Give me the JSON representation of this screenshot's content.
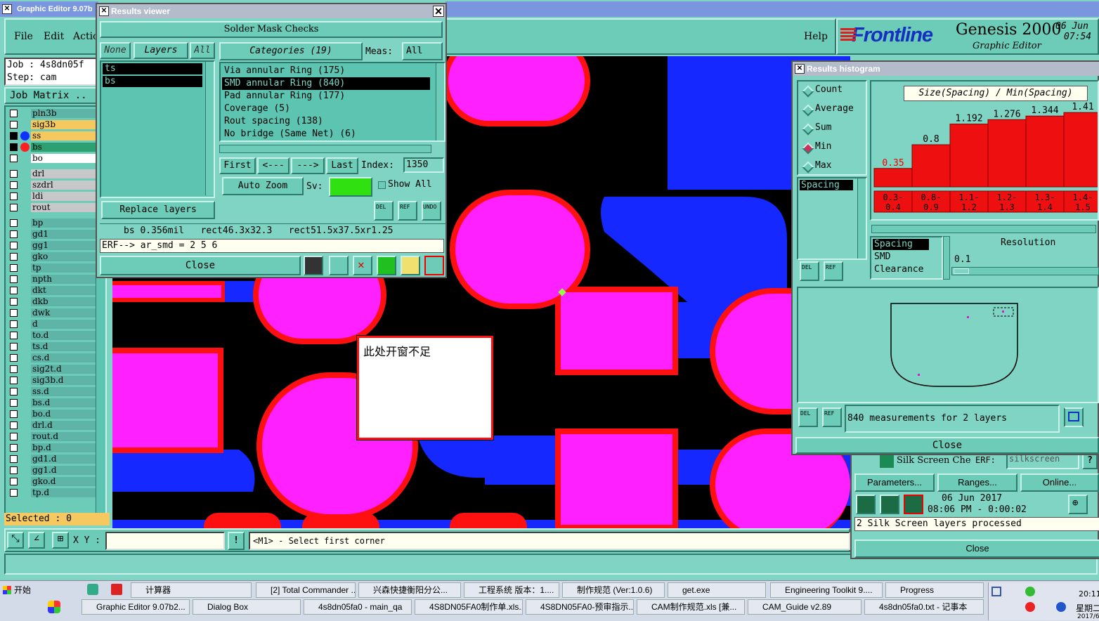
{
  "main_window": {
    "title": "Graphic Editor 9.07b",
    "menu": {
      "file": "File",
      "edit": "Edit",
      "actions": "Actio",
      "help": "Help"
    },
    "job": "Job : 4s8dn05f",
    "step": "Step: cam",
    "job_matrix": "Job Matrix ..",
    "selected": "Selected : 0",
    "xy_label": "X Y :",
    "xy_value": "",
    "hint_btn": "!",
    "hint": "<M1> - Select first corner"
  },
  "brand": {
    "logo": "Frontline",
    "product": "Genesis 2000",
    "subtitle": "Graphic Editor",
    "date": "06 Jun",
    "time": "07:54"
  },
  "layers": [
    {
      "name": "pln3b",
      "color": "#5fb4a8",
      "dot": ""
    },
    {
      "name": "sig3b",
      "color": "#f5c860",
      "dot": ""
    },
    {
      "name": "ss",
      "color": "#f5c860",
      "dot": "#1030ff"
    },
    {
      "name": "bs",
      "color": "#2ca070",
      "dot": "#ff2020"
    },
    {
      "name": "bo",
      "color": "#ffffff",
      "dot": ""
    },
    {
      "name": "drl",
      "color": "#c8c8c8",
      "dot": ""
    },
    {
      "name": "szdrl",
      "color": "#c8c8c8",
      "dot": ""
    },
    {
      "name": "ldi",
      "color": "#c8c8c8",
      "dot": ""
    },
    {
      "name": "rout",
      "color": "#c8c8c8",
      "dot": ""
    },
    {
      "name": "bp",
      "color": "#5fb4a8",
      "dot": ""
    },
    {
      "name": "gd1",
      "color": "#5fb4a8",
      "dot": ""
    },
    {
      "name": "gg1",
      "color": "#5fb4a8",
      "dot": ""
    },
    {
      "name": "gko",
      "color": "#5fb4a8",
      "dot": ""
    },
    {
      "name": "tp",
      "color": "#5fb4a8",
      "dot": ""
    },
    {
      "name": "npth",
      "color": "#5fb4a8",
      "dot": ""
    },
    {
      "name": "dkt",
      "color": "#5fb4a8",
      "dot": ""
    },
    {
      "name": "dkb",
      "color": "#5fb4a8",
      "dot": ""
    },
    {
      "name": "dwk",
      "color": "#5fb4a8",
      "dot": ""
    },
    {
      "name": "d",
      "color": "#5fb4a8",
      "dot": ""
    },
    {
      "name": "to.d",
      "color": "#5fb4a8",
      "dot": ""
    },
    {
      "name": "ts.d",
      "color": "#5fb4a8",
      "dot": ""
    },
    {
      "name": "cs.d",
      "color": "#5fb4a8",
      "dot": ""
    },
    {
      "name": "sig2t.d",
      "color": "#5fb4a8",
      "dot": ""
    },
    {
      "name": "sig3b.d",
      "color": "#5fb4a8",
      "dot": ""
    },
    {
      "name": "ss.d",
      "color": "#5fb4a8",
      "dot": ""
    },
    {
      "name": "bs.d",
      "color": "#5fb4a8",
      "dot": ""
    },
    {
      "name": "bo.d",
      "color": "#5fb4a8",
      "dot": ""
    },
    {
      "name": "drl.d",
      "color": "#5fb4a8",
      "dot": ""
    },
    {
      "name": "rout.d",
      "color": "#5fb4a8",
      "dot": ""
    },
    {
      "name": "bp.d",
      "color": "#5fb4a8",
      "dot": ""
    },
    {
      "name": "gd1.d",
      "color": "#5fb4a8",
      "dot": ""
    },
    {
      "name": "gg1.d",
      "color": "#5fb4a8",
      "dot": ""
    },
    {
      "name": "gko.d",
      "color": "#5fb4a8",
      "dot": ""
    },
    {
      "name": "tp.d",
      "color": "#5fb4a8",
      "dot": ""
    }
  ],
  "results_viewer": {
    "title": "Results viewer",
    "header": "Solder Mask Checks",
    "none": "None",
    "layers_label": "Layers",
    "all": "All",
    "categories_label": "Categories (19)",
    "meas_label": "Meas:",
    "meas_value": "All",
    "layer_items": [
      "ts",
      "bs"
    ],
    "categories": [
      "Via annular Ring (175)",
      "SMD annular Ring (840)",
      "Pad annular Ring (177)",
      "Coverage (5)",
      "Rout spacing (138)",
      "No bridge (Same Net) (6)"
    ],
    "first": "First",
    "prev": "<---",
    "next": "--->",
    "last": "Last",
    "index_label": "Index:",
    "index_value": "1350",
    "auto_zoom": "Auto Zoom",
    "sv_label": "Sv:",
    "show_all": "Show All",
    "replace_layers": "Replace layers",
    "del": "DEL",
    "ref": "REF",
    "undo": "UNDO",
    "info": "bs 0.356mil   rect46.3x32.3   rect51.5x37.5xr1.25",
    "erf": "ERF--> ar_smd = 2 5 6",
    "close": "Close"
  },
  "canvas": {
    "annotation": "此处开窗不足"
  },
  "histogram": {
    "title": "Results histogram",
    "options": [
      "Count",
      "Average",
      "Sum",
      "Min",
      "Max"
    ],
    "selected_option": "Min",
    "type_list": [
      "Spacing"
    ],
    "chart_title": "Size(Spacing) / Min(Spacing)",
    "list2": [
      "Spacing",
      "SMD",
      "Clearance"
    ],
    "resolution_label": "Resolution",
    "resolution_value": "0.1",
    "measurements": "840 measurements for 2 layers",
    "close": "Close",
    "del": "DEL",
    "ref": "REF",
    "chart_data": {
      "type": "bar",
      "title": "Size(Spacing) / Min(Spacing)",
      "categories": [
        "0.3-0.4",
        "0.8-0.9",
        "1.1-1.2",
        "1.2-1.3",
        "1.3-1.4",
        "1.4-1.5"
      ],
      "values": [
        0.35,
        0.8,
        1.192,
        1.276,
        1.344,
        1.411
      ],
      "labels": [
        "0.35",
        "0.8",
        "1.192",
        "1.276",
        "1.344",
        "1.41"
      ],
      "tick_labels": [
        [
          "0.3-",
          "0.4"
        ],
        [
          "0.8-",
          "0.9"
        ],
        [
          "1.1-",
          "1.2"
        ],
        [
          "1.2-",
          "1.3"
        ],
        [
          "1.3-",
          "1.4"
        ],
        [
          "1.4-",
          "1.5"
        ]
      ],
      "ylim": [
        0,
        1.6
      ]
    }
  },
  "silk": {
    "title": "Silk Screen Che",
    "erf": "ERF:",
    "erf_value": "silkscreen",
    "help": "?",
    "parameters": "Parameters...",
    "ranges": "Ranges...",
    "online": "Online...",
    "date": "06 Jun 2017",
    "time": "08:06 PM - 0:00:02",
    "status": "2 Silk Screen layers processed",
    "close": "Close"
  },
  "taskbar": {
    "start": "开始",
    "row1": [
      "计算器",
      "[2] Total Commander ...",
      "兴森快捷衡阳分公...",
      "工程系统  版本：1....",
      "制作规范 (Ver:1.0.6)",
      "get.exe",
      "Engineering Toolkit 9....",
      "Progress"
    ],
    "row2": [
      "Graphic Editor 9.07b2...",
      "Dialog Box",
      "4s8dn05fa0 - main_qa",
      "4S8DN05FA0制作单.xls...",
      "4S8DN05FA0-预审指示...",
      "CAM制作规范.xls [兼...",
      "CAM_Guide v2.89",
      "4s8dn05fa0.txt - 记事本"
    ],
    "clock": "20:11",
    "day": "星期二",
    "year": "2017/6"
  }
}
